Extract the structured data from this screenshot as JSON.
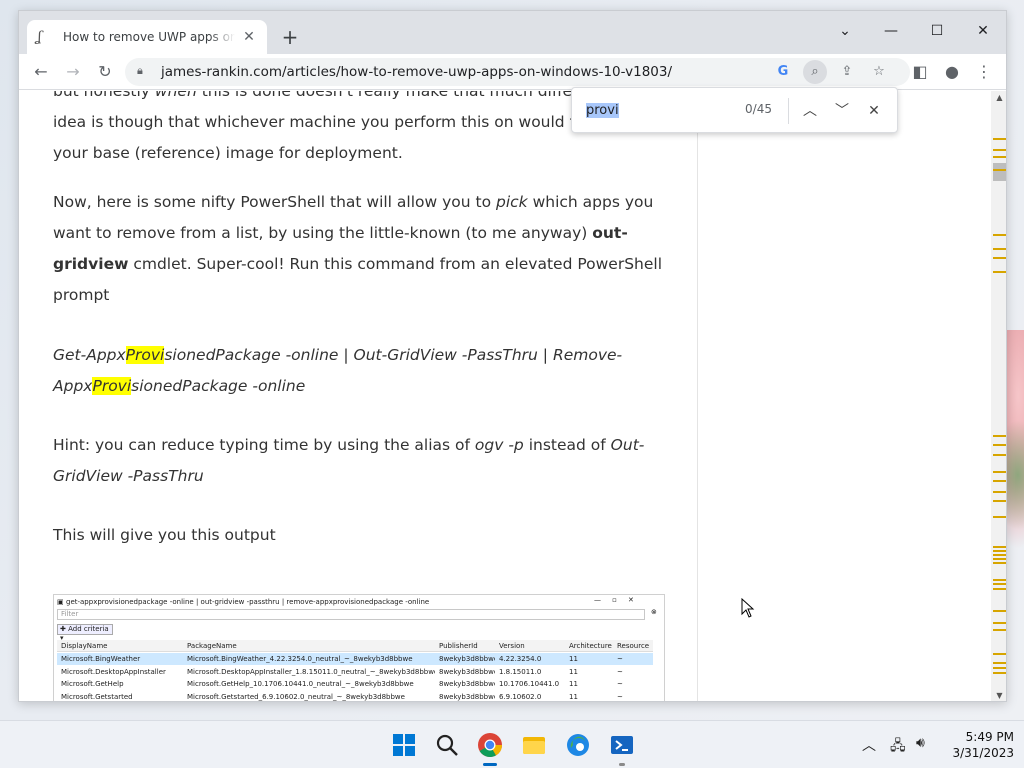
{
  "browser": {
    "tab_title": "How to remove UWP apps on W",
    "url": "james-rankin.com/articles/how-to-remove-uwp-apps-on-windows-10-v1803/"
  },
  "find_bar": {
    "query": "provi",
    "count": "0/45"
  },
  "article": {
    "lines": [
      {
        "segments": [
          {
            "t": "but honestly "
          },
          {
            "t": "when",
            "i": true
          },
          {
            "t": " this is done doesn't really make that much differe"
          }
        ]
      },
      {
        "segments": [
          {
            "t": "idea is though that whichever machine you perform this on would th"
          }
        ]
      },
      {
        "segments": [
          {
            "t": "your base (reference) image for deployment."
          }
        ]
      },
      {
        "segments": [
          {
            "t": "Now, here is some nifty PowerShell that will allow you to "
          },
          {
            "t": "pick",
            "i": true
          },
          {
            "t": " which apps you"
          }
        ]
      },
      {
        "segments": [
          {
            "t": "want to remove from a list, by using the little-known (to me anyway) "
          },
          {
            "t": "out-",
            "b": true
          }
        ]
      },
      {
        "segments": [
          {
            "t": "gridview",
            "b": true
          },
          {
            "t": " cmdlet. Super-cool! Run this command from an elevated PowerShell"
          }
        ]
      },
      {
        "segments": [
          {
            "t": "prompt"
          }
        ]
      },
      {
        "segments": [
          {
            "t": "Get-Appx",
            "i": true
          },
          {
            "t": "Provi",
            "i": true,
            "h": true
          },
          {
            "t": "sionedPackage -online | Out-GridView -PassThru | Remove-",
            "i": true
          }
        ]
      },
      {
        "segments": [
          {
            "t": "Appx",
            "i": true
          },
          {
            "t": "Provi",
            "i": true,
            "h": true
          },
          {
            "t": "sionedPackage -online",
            "i": true
          }
        ]
      },
      {
        "segments": [
          {
            "t": "Hint: you can reduce typing time by using the alias of "
          },
          {
            "t": "ogv -p",
            "i": true
          },
          {
            "t": " instead of "
          },
          {
            "t": "Out-",
            "i": true
          }
        ]
      },
      {
        "segments": [
          {
            "t": "GridView -PassThru",
            "i": true
          }
        ]
      },
      {
        "segments": [
          {
            "t": "This will give you this output"
          }
        ]
      }
    ]
  },
  "embedded_screenshot": {
    "title": "get-appxprovisionedpackage -online | out-gridview -passthru | remove-appxprovisionedpackage -online",
    "filter_placeholder": "Filter",
    "add_criteria": "Add criteria",
    "columns": [
      "DisplayName",
      "PackageName",
      "PublisherId",
      "Version",
      "Architecture",
      "ResourceId"
    ],
    "rows": [
      [
        "Microsoft.BingWeather",
        "Microsoft.BingWeather_4.22.3254.0_neutral_~_8wekyb3d8bbwe",
        "8wekyb3d8bbwe",
        "4.22.3254.0",
        "11",
        "~"
      ],
      [
        "Microsoft.DesktopAppInstaller",
        "Microsoft.DesktopAppInstaller_1.8.15011.0_neutral_~_8wekyb3d8bbwe",
        "8wekyb3d8bbwe",
        "1.8.15011.0",
        "11",
        "~"
      ],
      [
        "Microsoft.GetHelp",
        "Microsoft.GetHelp_10.1706.10441.0_neutral_~_8wekyb3d8bbwe",
        "8wekyb3d8bbwe",
        "10.1706.10441.0",
        "11",
        "~"
      ],
      [
        "Microsoft.Getstarted",
        "Microsoft.Getstarted_6.9.10602.0_neutral_~_8wekyb3d8bbwe",
        "8wekyb3d8bbwe",
        "6.9.10602.0",
        "11",
        "~"
      ]
    ]
  },
  "taskbar": {
    "time": "5:49 PM",
    "date": "3/31/2023"
  },
  "colors": {
    "highlight": "#ffff00",
    "scroll_marker": "#d7a500",
    "accent": "#0067c0"
  }
}
